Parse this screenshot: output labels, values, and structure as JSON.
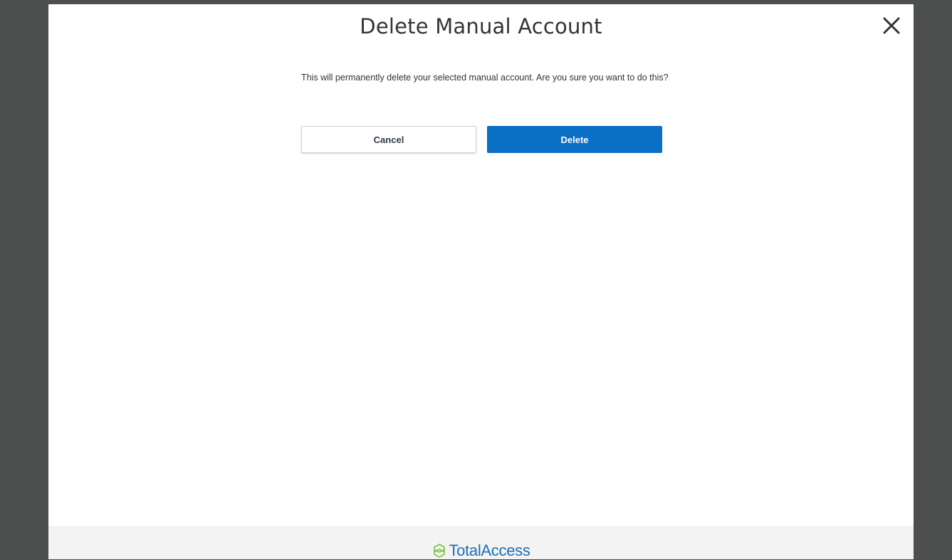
{
  "dialog": {
    "title": "Delete Manual Account",
    "message": "This will permanently delete your selected manual account. Are you sure you want to do this?",
    "cancel_label": "Cancel",
    "delete_label": "Delete",
    "close_icon": "close-icon"
  },
  "footer": {
    "brand_name": "TotalAccess",
    "brand_logo_icon": "totalaccess-logo-icon"
  },
  "colors": {
    "accent": "#0a70c6",
    "brand_text": "#1f6fb8",
    "brand_logo": "#7cc242",
    "backdrop": "#4d4e4e"
  }
}
